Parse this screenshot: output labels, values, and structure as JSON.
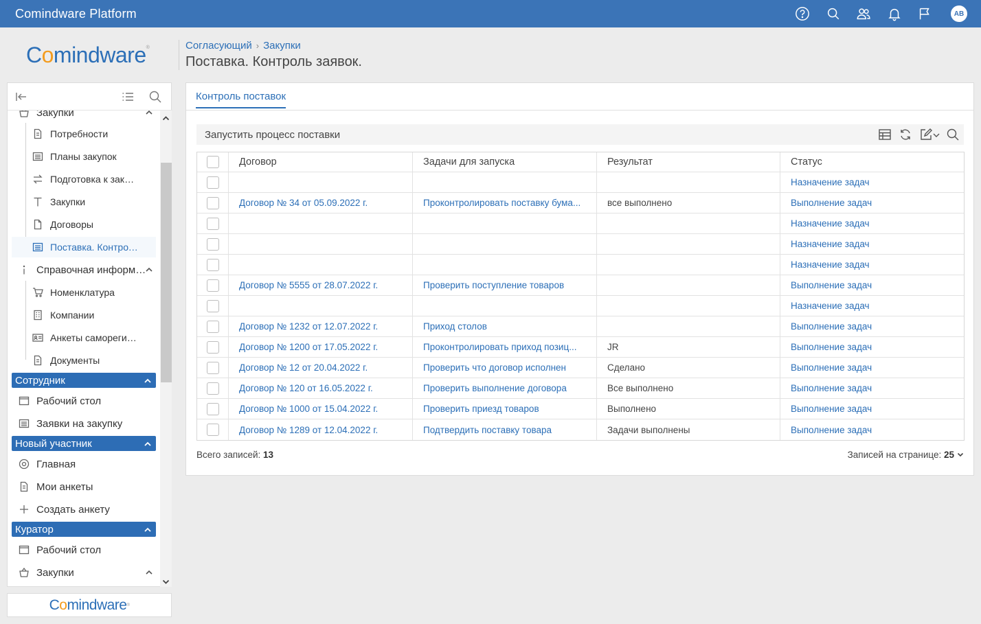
{
  "topbar": {
    "app_title": "Comindware Platform",
    "icons": [
      "help-icon",
      "search-icon",
      "users-icon",
      "bell-icon",
      "flag-icon"
    ],
    "avatar_initials": "AB"
  },
  "logo": {
    "prefix": "C",
    "o": "o",
    "rest": "mindware",
    "mark": "®"
  },
  "breadcrumb": {
    "parent": "Согласующий",
    "current": "Закупки"
  },
  "page_title": "Поставка. Контроль заявок.",
  "sidebar": {
    "top_item": "Закупки",
    "children": [
      {
        "label": "Потребности",
        "icon": "document-icon"
      },
      {
        "label": "Планы закупок",
        "icon": "list-icon"
      },
      {
        "label": "Подготовка к закупке",
        "icon": "exchange-icon"
      },
      {
        "label": "Закупки",
        "icon": "text-icon"
      },
      {
        "label": "Договоры",
        "icon": "file-icon"
      },
      {
        "label": "Поставка. Контроль заявок.",
        "icon": "list-icon"
      }
    ],
    "ref_section": "Справочная информация",
    "ref_children": [
      {
        "label": "Номенклатура",
        "icon": "cart-icon"
      },
      {
        "label": "Компании",
        "icon": "building-icon"
      },
      {
        "label": "Анкеты саморегистрации",
        "icon": "id-card-icon"
      },
      {
        "label": "Документы",
        "icon": "document-icon"
      }
    ],
    "groups": [
      {
        "title": "Сотрудник",
        "items": [
          {
            "label": "Рабочий стол",
            "icon": "desktop-icon"
          },
          {
            "label": "Заявки на закупку",
            "icon": "list-icon"
          }
        ]
      },
      {
        "title": "Новый участник",
        "items": [
          {
            "label": "Главная",
            "icon": "target-icon"
          },
          {
            "label": "Мои анкеты",
            "icon": "document-icon"
          },
          {
            "label": "Создать анкету",
            "icon": "plus-icon"
          }
        ]
      },
      {
        "title": "Куратор",
        "items": [
          {
            "label": "Рабочий стол",
            "icon": "desktop-icon"
          },
          {
            "label": "Закупки",
            "icon": "basket-icon"
          }
        ]
      }
    ]
  },
  "main": {
    "tab": "Контроль поставок",
    "toolbar": {
      "run_label": "Запустить процесс поставки"
    },
    "columns": [
      "Договор",
      "Задачи для запуска",
      "Результат",
      "Статус"
    ],
    "rows": [
      {
        "contract": "",
        "task": "",
        "result": "",
        "status": "Назначение задач"
      },
      {
        "contract": "Договор № 34 от 05.09.2022 г.",
        "task": "Проконтролировать поставку бума...",
        "result": "все выполнено",
        "status": "Выполнение задач"
      },
      {
        "contract": "",
        "task": "",
        "result": "",
        "status": "Назначение задач"
      },
      {
        "contract": "",
        "task": "",
        "result": "",
        "status": "Назначение задач"
      },
      {
        "contract": "",
        "task": "",
        "result": "",
        "status": "Назначение задач"
      },
      {
        "contract": "Договор № 5555 от 28.07.2022 г.",
        "task": "Проверить поступление товаров",
        "result": "",
        "status": "Выполнение задач"
      },
      {
        "contract": "",
        "task": "",
        "result": "",
        "status": "Назначение задач"
      },
      {
        "contract": "Договор № 1232 от 12.07.2022 г.",
        "task": "Приход столов",
        "result": "",
        "status": "Выполнение задач"
      },
      {
        "contract": "Договор № 1200 от 17.05.2022 г.",
        "task": "Проконтролировать приход позиц...",
        "result": "JR",
        "status": "Выполнение задач"
      },
      {
        "contract": "Договор № 12 от 20.04.2022 г.",
        "task": "Проверить что договор исполнен",
        "result": "Сделано",
        "status": "Выполнение задач"
      },
      {
        "contract": "Договор № 120 от 16.05.2022 г.",
        "task": "Проверить выполнение договора",
        "result": "Все выполнено",
        "status": "Выполнение задач"
      },
      {
        "contract": "Договор № 1000 от 15.04.2022 г.",
        "task": "Проверить приезд товаров",
        "result": "Выполнено",
        "status": "Выполнение задач"
      },
      {
        "contract": "Договор № 1289 от 12.04.2022 г.",
        "task": "Подтвердить поставку товара",
        "result": "Задачи выполнены",
        "status": "Выполнение задач"
      }
    ],
    "footer": {
      "total_label": "Всего записей:",
      "total_value": "13",
      "per_page_label": "Записей на странице:",
      "per_page_value": "25"
    }
  },
  "colors": {
    "brand": "#3b74b7",
    "link": "#2c6fb7",
    "group_header": "#2d6db5",
    "logo_accent": "#f39c1f"
  }
}
